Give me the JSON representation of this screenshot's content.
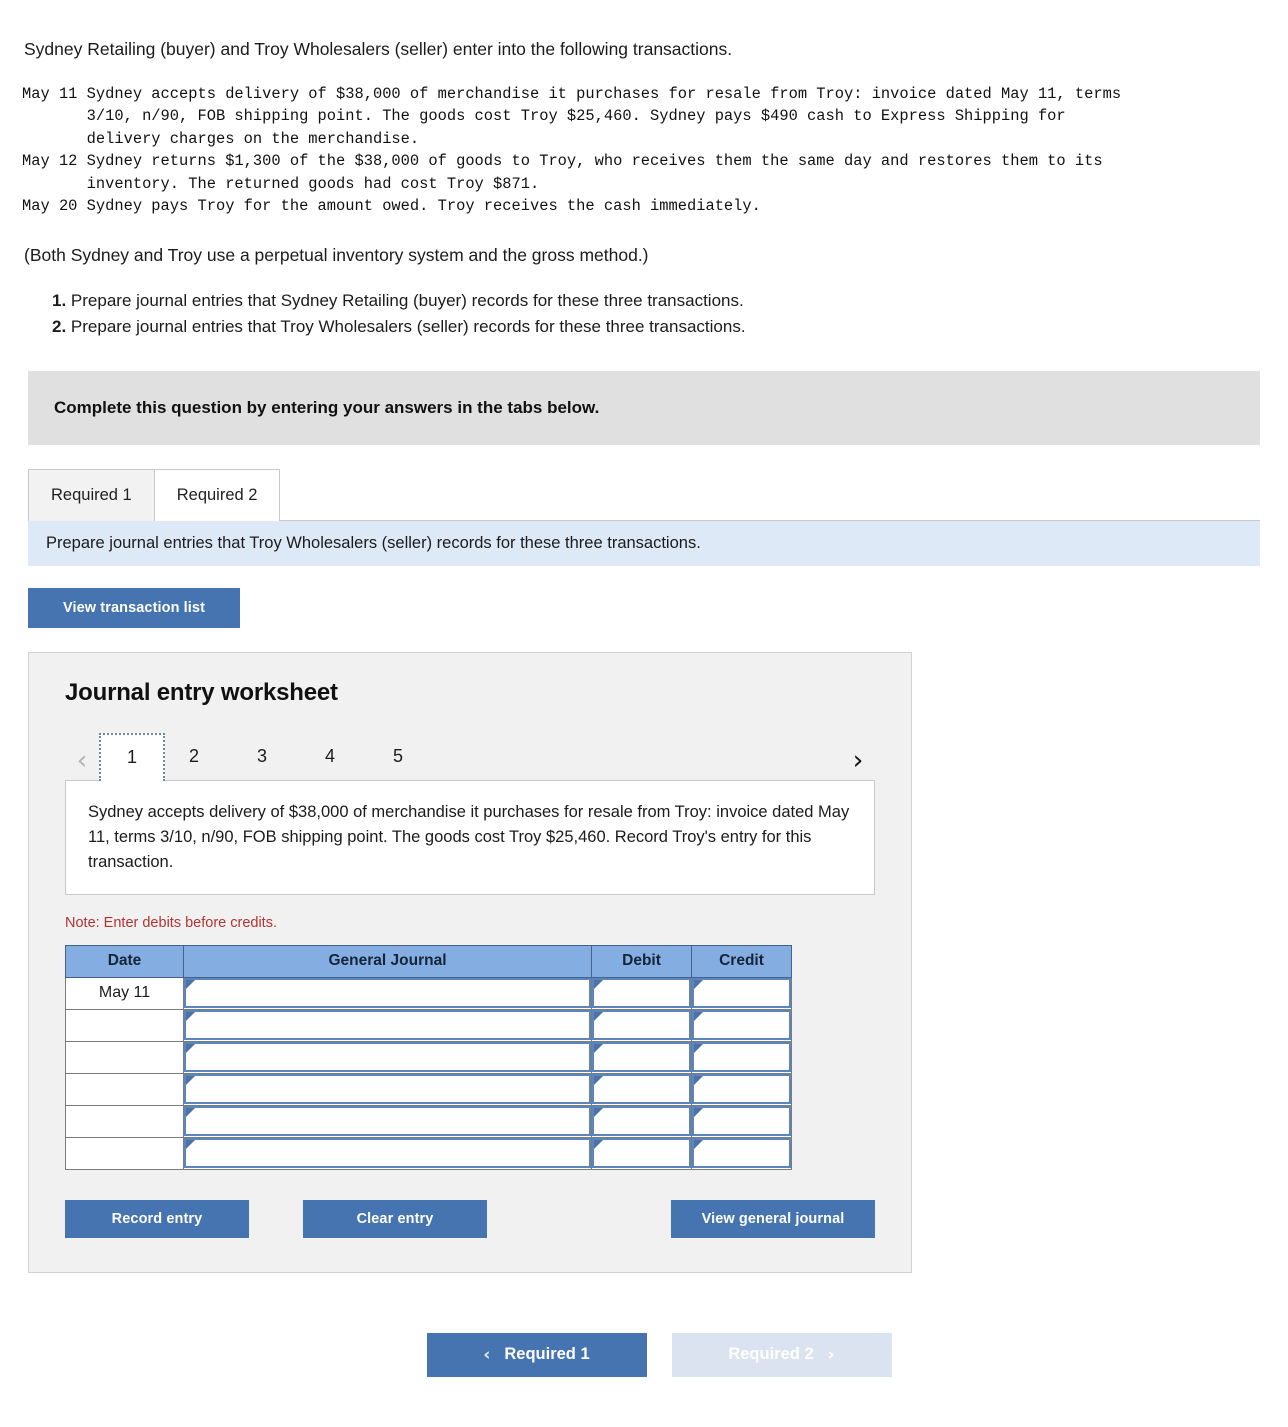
{
  "intro": {
    "lead": "Sydney Retailing (buyer) and Troy Wholesalers (seller) enter into the following transactions.",
    "transactions_text": "May 11 Sydney accepts delivery of $38,000 of merchandise it purchases for resale from Troy: invoice dated May 11, terms\n       3/10, n/90, FOB shipping point. The goods cost Troy $25,460. Sydney pays $490 cash to Express Shipping for\n       delivery charges on the merchandise.\nMay 12 Sydney returns $1,300 of the $38,000 of goods to Troy, who receives them the same day and restores them to its\n       inventory. The returned goods had cost Troy $871.\nMay 20 Sydney pays Troy for the amount owed. Troy receives the cash immediately.",
    "perpetual_note": "(Both Sydney and Troy use a perpetual inventory system and the gross method.)",
    "requirements": [
      {
        "num": "1.",
        "text": "Prepare journal entries that Sydney Retailing (buyer) records for these three transactions."
      },
      {
        "num": "2.",
        "text": "Prepare journal entries that Troy Wholesalers (seller) records for these three transactions."
      }
    ]
  },
  "complete_bar": {
    "text": "Complete this question by entering your answers in the tabs below."
  },
  "tabs": [
    {
      "label": "Required 1",
      "active": false
    },
    {
      "label": "Required 2",
      "active": true
    }
  ],
  "prompt_banner": {
    "text": "Prepare journal entries that Troy Wholesalers (seller) records for these three transactions."
  },
  "view_transaction_button": {
    "label": "View transaction list"
  },
  "worksheet": {
    "title": "Journal entry worksheet",
    "pager": {
      "prev_icon": "‹",
      "next_icon": "›",
      "pages": [
        "1",
        "2",
        "3",
        "4",
        "5"
      ],
      "active_page": "1"
    },
    "scenario": "Sydney accepts delivery of $38,000 of merchandise it purchases for resale from Troy: invoice dated May 11, terms 3/10, n/90, FOB shipping point. The goods cost Troy $25,460. Record Troy's entry for this transaction.",
    "note": "Note: Enter debits before credits.",
    "table": {
      "headers": [
        "Date",
        "General Journal",
        "Debit",
        "Credit"
      ],
      "rows": [
        {
          "date": "May 11",
          "general_journal": "",
          "debit": "",
          "credit": ""
        },
        {
          "date": "",
          "general_journal": "",
          "debit": "",
          "credit": ""
        },
        {
          "date": "",
          "general_journal": "",
          "debit": "",
          "credit": ""
        },
        {
          "date": "",
          "general_journal": "",
          "debit": "",
          "credit": ""
        },
        {
          "date": "",
          "general_journal": "",
          "debit": "",
          "credit": ""
        },
        {
          "date": "",
          "general_journal": "",
          "debit": "",
          "credit": ""
        }
      ]
    },
    "actions": {
      "record_entry": "Record entry",
      "clear_entry": "Clear entry",
      "view_general_journal": "View general journal"
    }
  },
  "bottom_nav": {
    "prev_arrow": "‹",
    "prev_label": "Required 1",
    "next_label": "Required 2",
    "next_arrow": "›"
  },
  "colors": {
    "button_blue": "#4574b0",
    "table_header_blue": "#84aee2",
    "banner_blue": "#dee9f7",
    "instruction_gray": "#e0e0e0",
    "note_red": "#b23434",
    "cell_border_blue": "#5b85bd",
    "disabled_blue": "#dae3ef"
  }
}
